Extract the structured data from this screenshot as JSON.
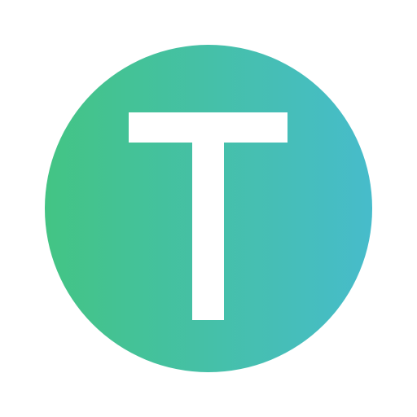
{
  "logo": {
    "letter": "T",
    "gradient_start_color": "#43c484",
    "gradient_end_color": "#47bccb",
    "letter_color": "#ffffff",
    "background_color": "#ffffff"
  }
}
